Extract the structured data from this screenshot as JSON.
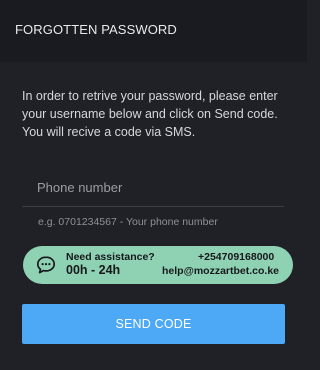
{
  "header": {
    "title": "FORGOTTEN PASSWORD"
  },
  "main": {
    "instructions": "In order to retrive your password, please enter your username below and click on Send code. You will recive a code via SMS.",
    "phone_input": {
      "placeholder": "Phone number",
      "value": ""
    },
    "phone_hint": "e.g. 0701234567 - Your phone number",
    "assistance": {
      "label": "Need assistance?",
      "hours": "00h - 24h",
      "phone": "+254709168000",
      "email": "help@mozzartbet.co.ke",
      "icon": "chat-bubble-icon"
    },
    "send_button_label": "SEND CODE"
  },
  "colors": {
    "background": "#1f2126",
    "header_background": "#191b20",
    "assistance_background": "#8ed1b3",
    "button_background": "#4da8f5"
  }
}
